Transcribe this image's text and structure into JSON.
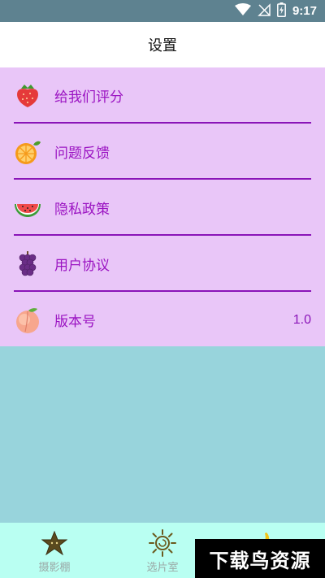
{
  "status_bar": {
    "time": "9:17"
  },
  "header": {
    "title": "设置"
  },
  "settings": {
    "items": [
      {
        "label": "给我们评分",
        "icon": "strawberry-icon",
        "value": ""
      },
      {
        "label": "问题反馈",
        "icon": "orange-icon",
        "value": ""
      },
      {
        "label": "隐私政策",
        "icon": "watermelon-icon",
        "value": ""
      },
      {
        "label": "用户协议",
        "icon": "grapes-icon",
        "value": ""
      },
      {
        "label": "版本号",
        "icon": "peach-icon",
        "value": "1.0"
      }
    ]
  },
  "bottom_nav": {
    "items": [
      {
        "label": "摄影棚",
        "icon": "star-icon"
      },
      {
        "label": "选片室",
        "icon": "sun-icon"
      },
      {
        "label": "",
        "icon": "banana-icon"
      }
    ]
  },
  "watermark": {
    "text": "下载鸟资源"
  },
  "colors": {
    "status_bar": "#5e8290",
    "panel": "#e9c6f8",
    "accent": "#9b14c2",
    "background": "#98d4dc",
    "bottom_nav": "#b9fff2"
  }
}
